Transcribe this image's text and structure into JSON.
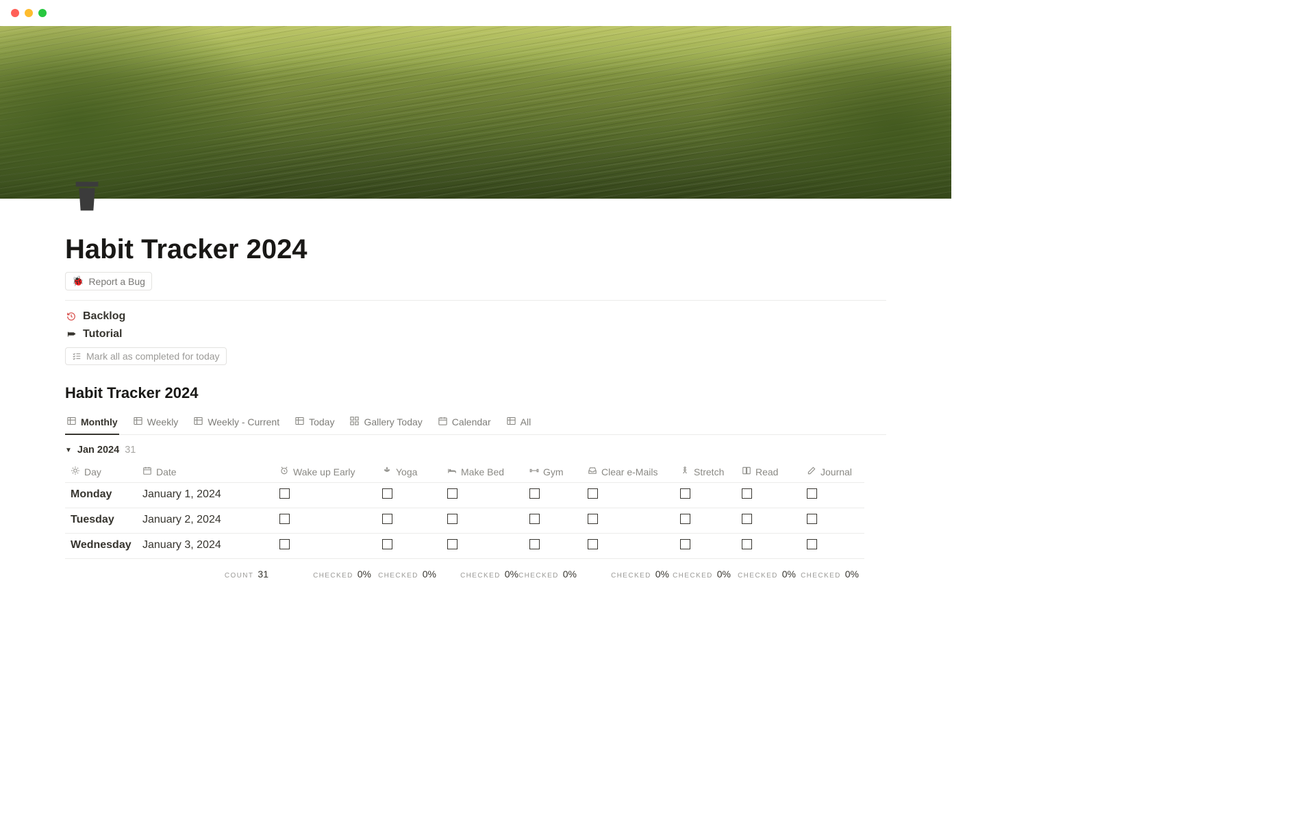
{
  "page": {
    "title": "Habit Tracker 2024",
    "icon": "🗑️",
    "report_bug": {
      "emoji": "🐞",
      "label": "Report a Bug"
    },
    "links": [
      {
        "icon": "history",
        "label": "Backlog",
        "color": "red"
      },
      {
        "icon": "pin",
        "label": "Tutorial",
        "color": "dark"
      }
    ],
    "mark_all": {
      "label": "Mark all as completed for today"
    }
  },
  "db": {
    "title": "Habit Tracker 2024",
    "tabs": [
      {
        "icon": "table",
        "label": "Monthly",
        "active": true
      },
      {
        "icon": "table",
        "label": "Weekly"
      },
      {
        "icon": "table",
        "label": "Weekly - Current"
      },
      {
        "icon": "table",
        "label": "Today"
      },
      {
        "icon": "gallery",
        "label": "Gallery Today"
      },
      {
        "icon": "calendar",
        "label": "Calendar"
      },
      {
        "icon": "table",
        "label": "All"
      }
    ],
    "group": {
      "name": "Jan 2024",
      "count": "31"
    },
    "columns": [
      {
        "icon": "sun",
        "label": "Day"
      },
      {
        "icon": "calendar",
        "label": "Date"
      },
      {
        "icon": "alarm",
        "label": "Wake up Early"
      },
      {
        "icon": "lotus",
        "label": "Yoga"
      },
      {
        "icon": "bed",
        "label": "Make Bed"
      },
      {
        "icon": "dumbbell",
        "label": "Gym"
      },
      {
        "icon": "inbox",
        "label": "Clear e-Mails"
      },
      {
        "icon": "person",
        "label": "Stretch"
      },
      {
        "icon": "book",
        "label": "Read"
      },
      {
        "icon": "edit",
        "label": "Journal"
      }
    ],
    "rows": [
      {
        "day": "Monday",
        "date": "January 1, 2024"
      },
      {
        "day": "Tuesday",
        "date": "January 2, 2024"
      },
      {
        "day": "Wednesday",
        "date": "January 3, 2024"
      }
    ],
    "footer": {
      "count": {
        "label": "COUNT",
        "value": "31"
      },
      "checked": {
        "label": "CHECKED",
        "value": "0%"
      }
    }
  }
}
